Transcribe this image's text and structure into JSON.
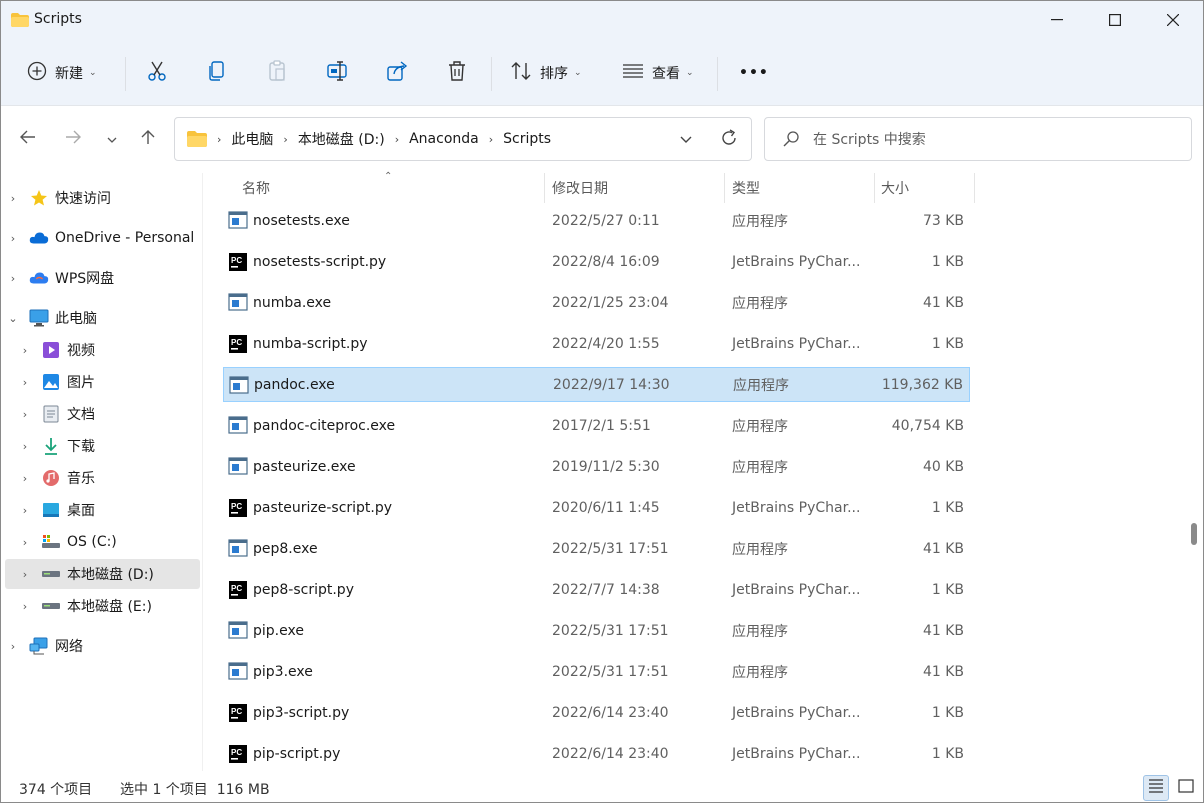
{
  "window": {
    "title": "Scripts"
  },
  "toolbar": {
    "new_label": "新建",
    "sort_label": "排序",
    "view_label": "查看",
    "more": "•••"
  },
  "address": {
    "crumbs": [
      "此电脑",
      "本地磁盘 (D:)",
      "Anaconda",
      "Scripts"
    ]
  },
  "search": {
    "placeholder": "在 Scripts 中搜索"
  },
  "sidebar": {
    "items": [
      {
        "label": "快速访问",
        "icon": "star-icon"
      },
      {
        "label": "OneDrive - Personal",
        "icon": "onedrive-icon"
      },
      {
        "label": "WPS网盘",
        "icon": "wps-cloud-icon"
      },
      {
        "label": "此电脑",
        "icon": "computer-icon"
      },
      {
        "label": "视频",
        "icon": "video-folder-icon"
      },
      {
        "label": "图片",
        "icon": "pictures-folder-icon"
      },
      {
        "label": "文档",
        "icon": "documents-folder-icon"
      },
      {
        "label": "下载",
        "icon": "download-folder-icon"
      },
      {
        "label": "音乐",
        "icon": "music-folder-icon"
      },
      {
        "label": "桌面",
        "icon": "desktop-folder-icon"
      },
      {
        "label": "OS (C:)",
        "icon": "system-drive-icon"
      },
      {
        "label": "本地磁盘 (D:)",
        "icon": "drive-icon"
      },
      {
        "label": "本地磁盘 (E:)",
        "icon": "drive-icon"
      },
      {
        "label": "网络",
        "icon": "network-icon"
      }
    ]
  },
  "columns": {
    "name": "名称",
    "date": "修改日期",
    "type": "类型",
    "size": "大小"
  },
  "files": [
    {
      "name": "nosetests.exe",
      "date": "2022/5/27 0:11",
      "type": "应用程序",
      "size": "73 KB",
      "icon": "exe-icon"
    },
    {
      "name": "nosetests-script.py",
      "date": "2022/8/4 16:09",
      "type": "JetBrains PyChar...",
      "size": "1 KB",
      "icon": "pycharm-file-icon"
    },
    {
      "name": "numba.exe",
      "date": "2022/1/25 23:04",
      "type": "应用程序",
      "size": "41 KB",
      "icon": "exe-icon"
    },
    {
      "name": "numba-script.py",
      "date": "2022/4/20 1:55",
      "type": "JetBrains PyChar...",
      "size": "1 KB",
      "icon": "pycharm-file-icon"
    },
    {
      "name": "pandoc.exe",
      "date": "2022/9/17 14:30",
      "type": "应用程序",
      "size": "119,362 KB",
      "icon": "exe-icon",
      "selected": true
    },
    {
      "name": "pandoc-citeproc.exe",
      "date": "2017/2/1 5:51",
      "type": "应用程序",
      "size": "40,754 KB",
      "icon": "exe-icon"
    },
    {
      "name": "pasteurize.exe",
      "date": "2019/11/2 5:30",
      "type": "应用程序",
      "size": "40 KB",
      "icon": "exe-icon"
    },
    {
      "name": "pasteurize-script.py",
      "date": "2020/6/11 1:45",
      "type": "JetBrains PyChar...",
      "size": "1 KB",
      "icon": "pycharm-file-icon"
    },
    {
      "name": "pep8.exe",
      "date": "2022/5/31 17:51",
      "type": "应用程序",
      "size": "41 KB",
      "icon": "exe-icon"
    },
    {
      "name": "pep8-script.py",
      "date": "2022/7/7 14:38",
      "type": "JetBrains PyChar...",
      "size": "1 KB",
      "icon": "pycharm-file-icon"
    },
    {
      "name": "pip.exe",
      "date": "2022/5/31 17:51",
      "type": "应用程序",
      "size": "41 KB",
      "icon": "exe-icon"
    },
    {
      "name": "pip3.exe",
      "date": "2022/5/31 17:51",
      "type": "应用程序",
      "size": "41 KB",
      "icon": "exe-icon"
    },
    {
      "name": "pip3-script.py",
      "date": "2022/6/14 23:40",
      "type": "JetBrains PyChar...",
      "size": "1 KB",
      "icon": "pycharm-file-icon"
    },
    {
      "name": "pip-script.py",
      "date": "2022/6/14 23:40",
      "type": "JetBrains PyChar...",
      "size": "1 KB",
      "icon": "pycharm-file-icon"
    }
  ],
  "status": {
    "count": "374 个项目",
    "selection": "选中 1 个项目  116 MB"
  },
  "colors": {
    "chrome_bg": "#eef3fa",
    "selection_bg": "#cce4f7",
    "selection_border": "#99d1ff",
    "folder": "#f8c33c",
    "accent": "#0067c0"
  }
}
